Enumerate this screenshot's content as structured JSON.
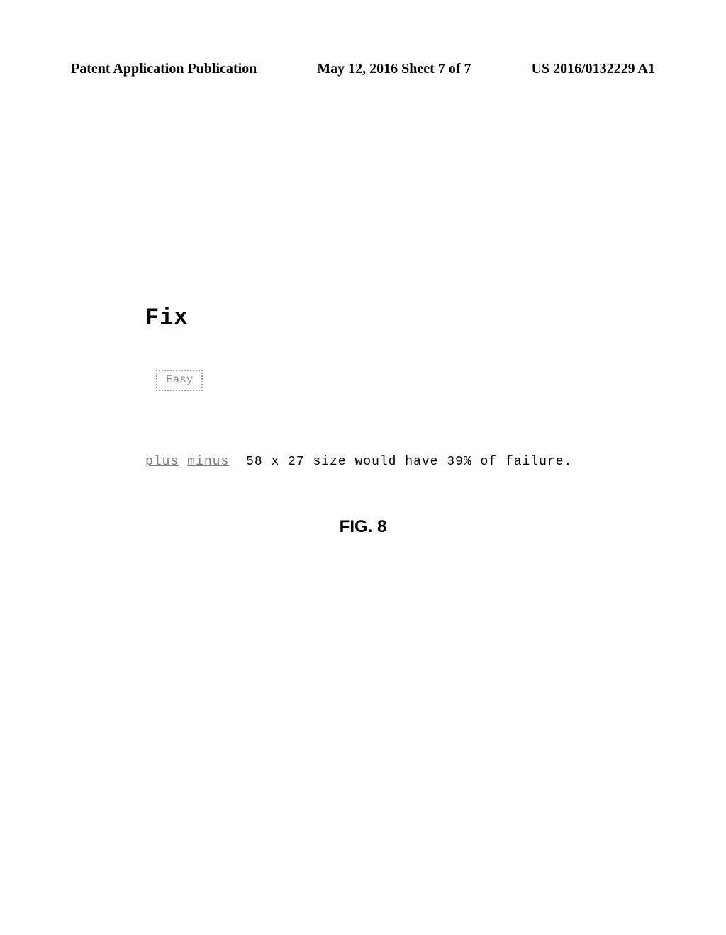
{
  "header": {
    "left": "Patent Application Publication",
    "center": "May 12, 2016  Sheet 7 of 7",
    "right": "US 2016/0132229 A1"
  },
  "figure": {
    "fix_label": "Fix",
    "easy_label": "Easy",
    "plus_label": "plus",
    "minus_label": "minus",
    "status_rest": " 58 x 27 size would have 39% of failure.",
    "caption": "FIG. 8"
  }
}
